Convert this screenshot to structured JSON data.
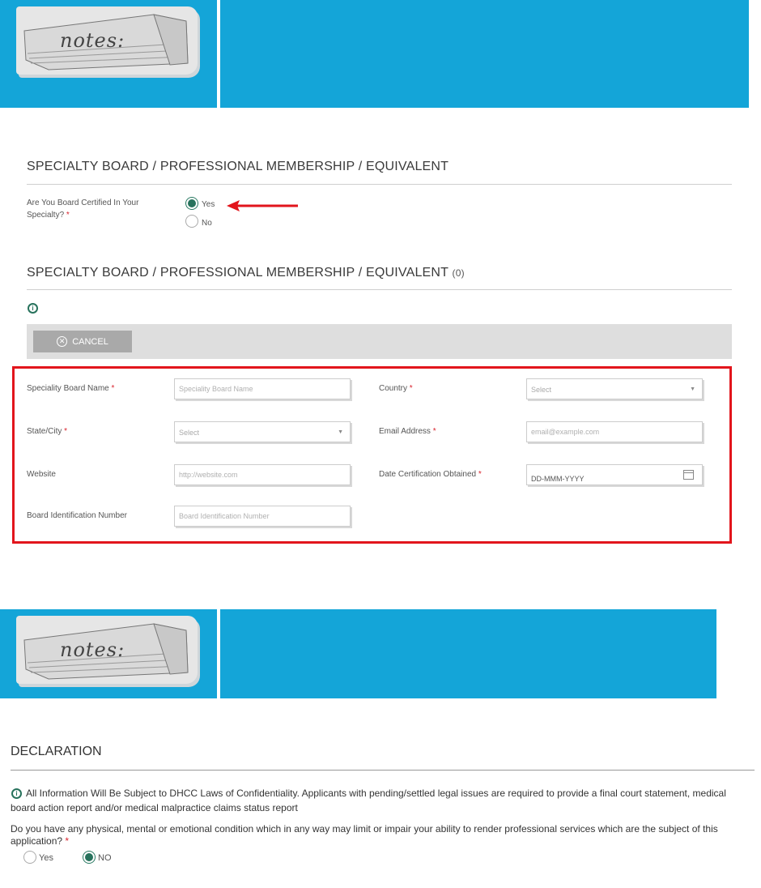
{
  "banners": [
    {
      "note_text": "notes:"
    },
    {
      "note_text": "notes:"
    }
  ],
  "section1": {
    "title": "SPECIALTY BOARD / PROFESSIONAL MEMBERSHIP / EQUIVALENT",
    "question": "Are You Board Certified In Your Specialty?",
    "required_mark": "*",
    "options": [
      {
        "label": "Yes",
        "selected": true
      },
      {
        "label": "No",
        "selected": false
      }
    ]
  },
  "section2": {
    "title": "SPECIALTY BOARD / PROFESSIONAL MEMBERSHIP / EQUIVALENT",
    "count": "(0)",
    "cancel_label": "CANCEL"
  },
  "form": {
    "specialty_board_name": {
      "label": "Speciality Board Name",
      "placeholder": "Speciality Board Name"
    },
    "country": {
      "label": "Country",
      "value": "Select"
    },
    "state_city": {
      "label": "State/City",
      "value": "Select"
    },
    "email": {
      "label": "Email Address",
      "placeholder": "email@example.com"
    },
    "website": {
      "label": "Website",
      "placeholder": "http://website.com"
    },
    "date_obtained": {
      "label": "Date Certification Obtained",
      "value": "DD-MMM-YYYY"
    },
    "board_id": {
      "label": "Board Identification Number",
      "placeholder": "Board Identification Number"
    },
    "required_mark": "*"
  },
  "declaration": {
    "title": "DECLARATION",
    "info_text": "All Information Will Be Subject to DHCC Laws of Confidentiality. Applicants with pending/settled legal issues are required to provide a final court statement, medical board action report and/or medical malpractice claims status report",
    "question": "Do you have any physical, mental or emotional condition which in any way may limit or impair your ability to render professional services which are the subject of this application?",
    "required_mark": "*",
    "options": [
      {
        "label": "Yes",
        "selected": false
      },
      {
        "label": "NO",
        "selected": true
      }
    ]
  },
  "colors": {
    "banner": "#14a5d8",
    "accent_green": "#27725c",
    "highlight_red": "#e2151c"
  }
}
